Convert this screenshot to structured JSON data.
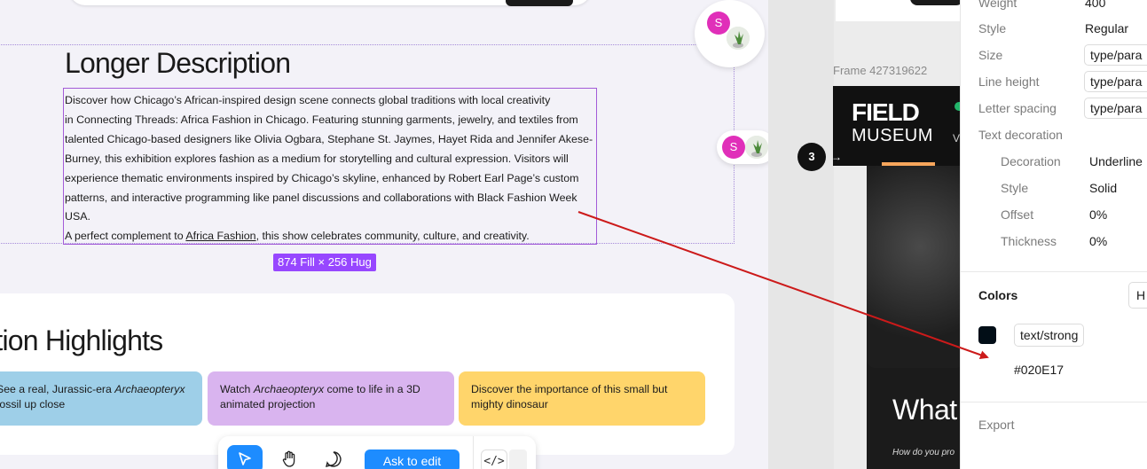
{
  "canvas": {
    "heading_longer": "Longer Description",
    "description_lines": [
      "Discover how Chicago’s African-inspired design scene connects global traditions with local creativity",
      "in Connecting Threads: Africa Fashion in Chicago. Featuring stunning garments, jewelry, and textiles from",
      "talented Chicago-based designers like Olivia Ogbara, Stephane St. Jaymes, Hayet Rida and Jennifer Akese-",
      "Burney, this exhibition explores fashion as a medium for storytelling and cultural expression. Visitors will",
      "experience thematic environments inspired by Chicago’s skyline, enhanced by Robert Earl Page’s custom",
      "patterns, and interactive programming like panel discussions and collaborations with Black Fashion Week",
      "USA."
    ],
    "complement_prefix": "A perfect complement to ",
    "complement_link": "Africa Fashion",
    "complement_suffix": ", this show celebrates community, culture, and creativity.",
    "dimension_badge": "874 Fill × 256 Hug",
    "heading_highlights": "Exhibition Highlights",
    "highlight_cards": [
      {
        "pre": "See a real, Jurassic-era ",
        "em": "Archaeopteryx",
        "post": " fossil up close"
      },
      {
        "pre": "Watch ",
        "em": "Archaeopteryx",
        "post": " come to life in a 3D animated projection"
      },
      {
        "pre": "Discover the importance of this small but mighty dinosaur",
        "em": "",
        "post": ""
      }
    ],
    "highlight_colors": [
      "#9ecfe8",
      "#d9b4ef",
      "#ffd56b"
    ],
    "collaborator_initial": "S",
    "collaborator_color": "#e02fb9"
  },
  "toolbar": {
    "select_icon": "cursor-icon",
    "hand_icon": "hand-icon",
    "comment_icon": "comment-icon",
    "ask_label": "Ask to edit",
    "code_label": "</>",
    "accent": "#1d8cff"
  },
  "frame": {
    "label": "Frame 427319622",
    "logo_line1": "FIELD",
    "logo_line2": "MUSEUM",
    "logo_tail": "V",
    "headline": "What",
    "subhead": "How do you pro",
    "step_number": "3"
  },
  "inspector": {
    "weight_label": "Weight",
    "weight_value": "400",
    "style_label": "Style",
    "style_value": "Regular",
    "size_label": "Size",
    "size_value": "type/para",
    "line_height_label": "Line height",
    "line_height_value": "type/para",
    "letter_spacing_label": "Letter spacing",
    "letter_spacing_value": "type/para",
    "text_decoration_label": "Text decoration",
    "decoration_label": "Decoration",
    "decoration_value": "Underline",
    "deco_style_label": "Style",
    "deco_style_value": "Solid",
    "offset_label": "Offset",
    "offset_value": "0%",
    "thickness_label": "Thickness",
    "thickness_value": "0%",
    "colors_title": "Colors",
    "colors_button": "H",
    "color_token": "text/strong",
    "color_hex": "#020E17",
    "export_title": "Export"
  },
  "annotation_color": "#cc1a1a",
  "selection_color": "#9747ff"
}
